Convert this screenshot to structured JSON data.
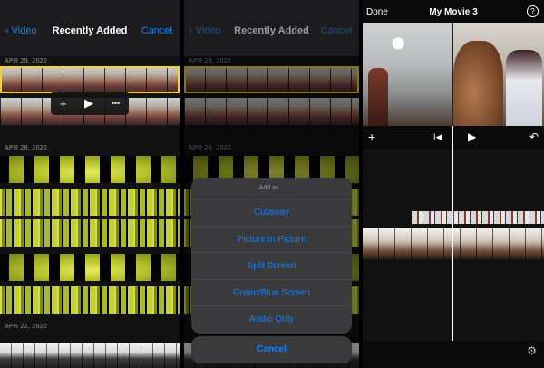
{
  "panel1": {
    "back_label": "Video",
    "title": "Recently Added",
    "cancel_label": "Cancel",
    "dates": [
      "APR 29, 2022",
      "APR 28, 2022",
      "APR 22, 2022"
    ],
    "clip_actions": {
      "add": "+",
      "play": "▶",
      "more": "•••"
    }
  },
  "panel2": {
    "back_label": "Video",
    "title": "Recently Added",
    "cancel_label": "Cancel",
    "dates": [
      "APR 29, 2022",
      "APR 28, 2022"
    ],
    "sheet": {
      "title": "Add as...",
      "options": [
        "Cutaway",
        "Picture in Picture",
        "Split Screen",
        "Green/Blue Screen",
        "Audio Only"
      ],
      "cancel": "Cancel"
    }
  },
  "panel3": {
    "done_label": "Done",
    "title": "My Movie 3",
    "help_icon": "?",
    "tools": {
      "add": "+",
      "skip_back": "I◀",
      "play": "▶",
      "undo": "↶"
    },
    "settings_icon": "⚙"
  },
  "colors": {
    "accent": "#0a84ff",
    "selection": "#f7d22b",
    "sheet_bg": "#3a3a3c"
  }
}
